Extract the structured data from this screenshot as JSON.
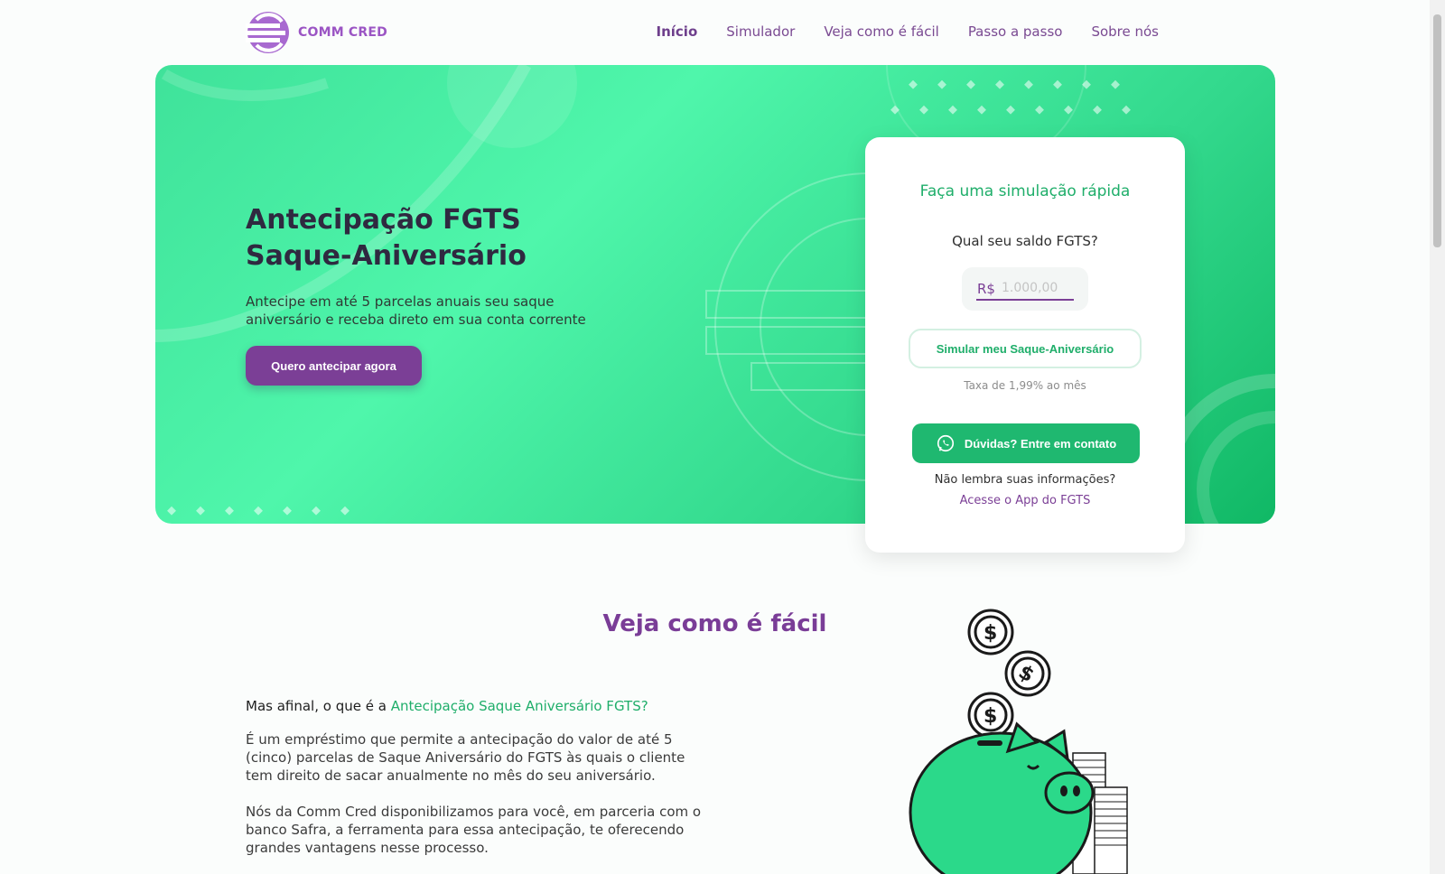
{
  "brand": {
    "name": "COMM CRED",
    "accent": "#9b55c4",
    "green": "#1fae6a"
  },
  "nav": {
    "items": [
      {
        "label": "Início"
      },
      {
        "label": "Simulador"
      },
      {
        "label": "Veja como é fácil"
      },
      {
        "label": "Passo a passo"
      },
      {
        "label": "Sobre nós"
      }
    ],
    "active": "Início"
  },
  "hero": {
    "title": "Antecipação FGTS Saque-Aniversário",
    "subtitle": "Antecipe em até 5 parcelas anuais seu saque aniversário e receba direto em sua conta corrente",
    "cta_label": "Quero antecipar agora"
  },
  "simulator": {
    "title": "Faça uma simulação rápida",
    "question": "Qual seu saldo FGTS?",
    "currency": "R$",
    "placeholder": "1.000,00",
    "submit_label": "Simular meu Saque-Aniversário",
    "rate": "Taxa de 1,99% ao mês",
    "whatsapp_label": "Dúvidas? Entre em contato",
    "whatsapp_icon": "whatsapp-icon",
    "note": "Não lembra suas informações?",
    "link": "Acesse o App do FGTS"
  },
  "section": {
    "title": "Veja como é fácil",
    "question_prefix": "Mas afinal, o que é a ",
    "question_highlight": "Antecipação Saque Aniversário FGTS?",
    "paragraph1": "É um empréstimo que permite a antecipação do valor de até 5 (cinco) parcelas de Saque Aniversário do FGTS às quais o cliente tem direito de sacar anualmente no mês do seu aniversário.",
    "paragraph2": "Nós da Comm Cred disponibilizamos para você, em parceria com o banco Safra, a ferramenta para essa antecipação, te oferecendo grandes vantagens nesse processo.",
    "illustration": "piggy-bank-coins"
  }
}
